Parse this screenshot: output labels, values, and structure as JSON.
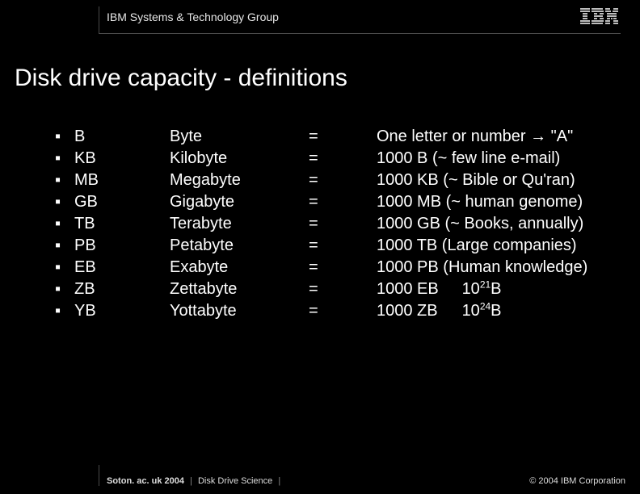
{
  "header": {
    "group": "IBM Systems & Technology Group",
    "logo_name": "ibm-logo"
  },
  "title": "Disk drive capacity - definitions",
  "rows": [
    {
      "abbrev": "B",
      "name": "Byte",
      "eq": "=",
      "def": "One letter or number → \"A\""
    },
    {
      "abbrev": "KB",
      "name": "Kilobyte",
      "eq": "=",
      "def": "1000 B (~ few line e-mail)"
    },
    {
      "abbrev": "MB",
      "name": "Megabyte",
      "eq": "=",
      "def": "1000 KB (~ Bible or Qu'ran)"
    },
    {
      "abbrev": "GB",
      "name": "Gigabyte",
      "eq": "=",
      "def": "1000 MB (~ human genome)"
    },
    {
      "abbrev": "TB",
      "name": "Terabyte",
      "eq": "=",
      "def": "1000 GB (~ Books, annually)"
    },
    {
      "abbrev": "PB",
      "name": "Petabyte",
      "eq": "=",
      "def": "1000 TB (Large companies)"
    },
    {
      "abbrev": "EB",
      "name": "Exabyte",
      "eq": "=",
      "def": "1000 PB (Human knowledge)"
    },
    {
      "abbrev": "ZB",
      "name": "Zettabyte",
      "eq": "=",
      "def_a": "1000 EB",
      "def_b_pre": "10",
      "def_b_sup": "21",
      "def_b_post": "B"
    },
    {
      "abbrev": "YB",
      "name": "Yottabyte",
      "eq": "=",
      "def_a": "1000 ZB",
      "def_b_pre": "10",
      "def_b_sup": "24",
      "def_b_post": "B"
    }
  ],
  "footer": {
    "left_a": "Soton. ac. uk 2004",
    "left_b": "Disk Drive Science",
    "sep": "|",
    "right": "© 2004 IBM Corporation"
  },
  "bullet": "▪"
}
